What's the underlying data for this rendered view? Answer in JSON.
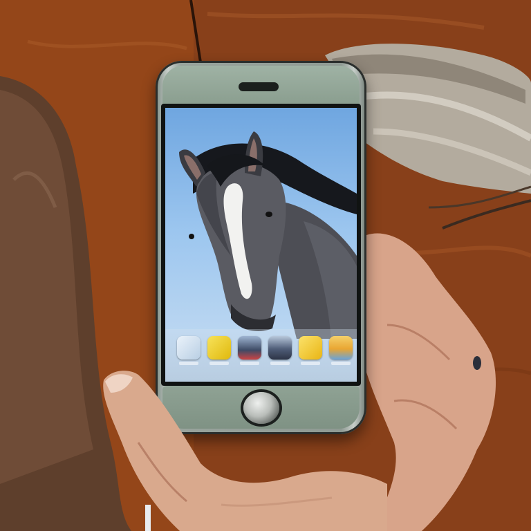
{
  "scene": {
    "description_free": true,
    "colors": {
      "table_wood": "#8a3d16",
      "phone_body": "#889c8d",
      "sky_top": "#6fa6e0",
      "horse_coat": "#55555c",
      "leather": "#6b4a36",
      "cloth": "#b7b1a4"
    }
  },
  "phone": {
    "status_bar": {
      "left": "",
      "center": "",
      "right": ""
    },
    "dock": {
      "apps": [
        {
          "icon": "phone-icon",
          "color": "#d9e7f4"
        },
        {
          "icon": "yellow-app-icon",
          "color": "#f2d51f"
        },
        {
          "icon": "photo-app-icon",
          "color": "#5a6b88"
        },
        {
          "icon": "photo-app-icon",
          "color": "#6d7b90"
        },
        {
          "icon": "yellow-app-icon",
          "color": "#f0c61c"
        },
        {
          "icon": "landscape-app-icon",
          "color": "#e8b43c"
        }
      ]
    }
  }
}
